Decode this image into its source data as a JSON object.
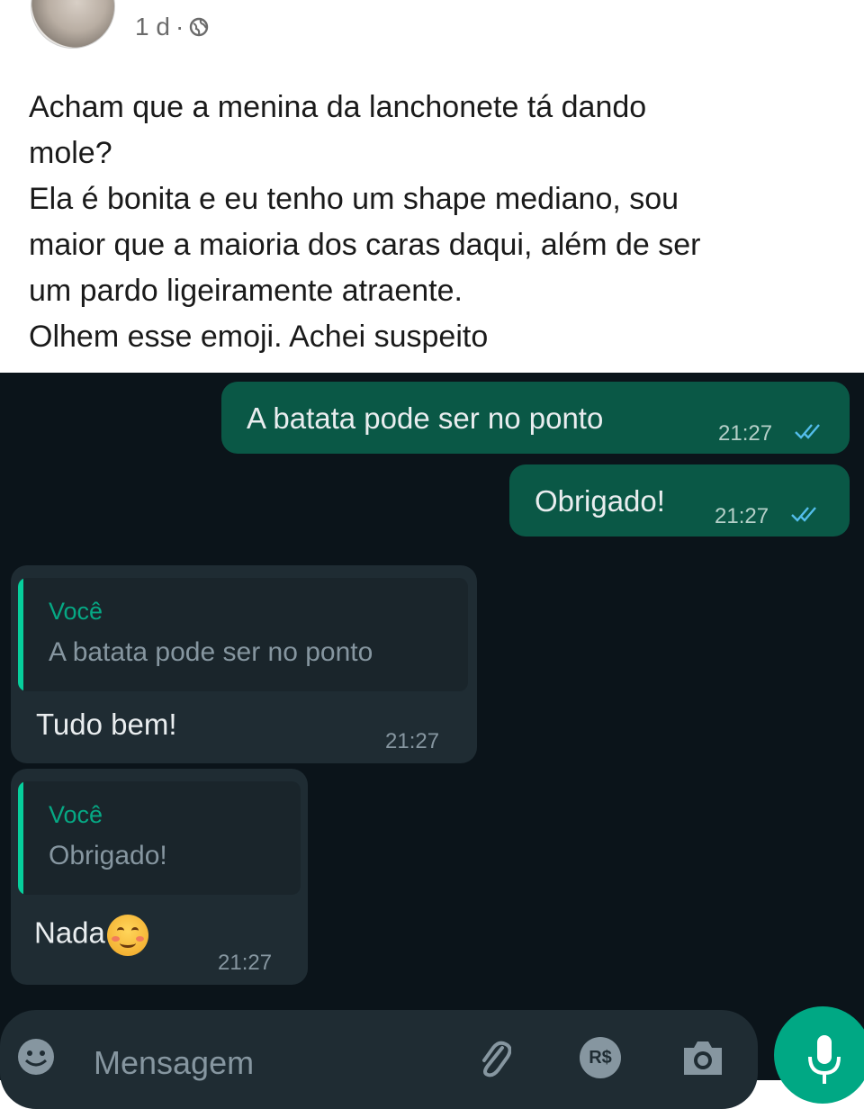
{
  "post": {
    "time": "1 d",
    "separator": "·",
    "icon": "globe-icon",
    "lines": [
      "Acham que a menina da lanchonete tá dando",
      "mole?",
      "Ela é bonita e eu tenho um shape mediano, sou",
      "maior que a maioria dos caras daqui, além de ser",
      "um pardo ligeiramente atraente.",
      "Olhem esse emoji. Achei suspeito"
    ]
  },
  "chat": {
    "outgoing": [
      {
        "text": "A batata pode ser no ponto",
        "time": "21:27",
        "status": "read-ticks-icon"
      },
      {
        "text": "Obrigado!",
        "time": "21:27",
        "status": "read-ticks-icon"
      }
    ],
    "incoming": [
      {
        "quote_author": "Você",
        "quote_text": "A batata pode ser no ponto",
        "text": "Tudo bem!",
        "time": "21:27"
      },
      {
        "quote_author": "Você",
        "quote_text": "Obrigado!",
        "text": "Nada",
        "emoji": "smiling-blush-emoji",
        "time": "21:27"
      }
    ]
  },
  "composer": {
    "placeholder": "Mensagem",
    "icons": [
      "emoji-icon",
      "attach-icon",
      "currency-icon",
      "camera-icon",
      "mic-icon"
    ],
    "currency_label": "R$"
  },
  "colors": {
    "chat_background": "#0b141a",
    "outgoing_bubble": "#0a5846",
    "incoming_bubble": "#1f2c33",
    "accent": "#00a884"
  }
}
